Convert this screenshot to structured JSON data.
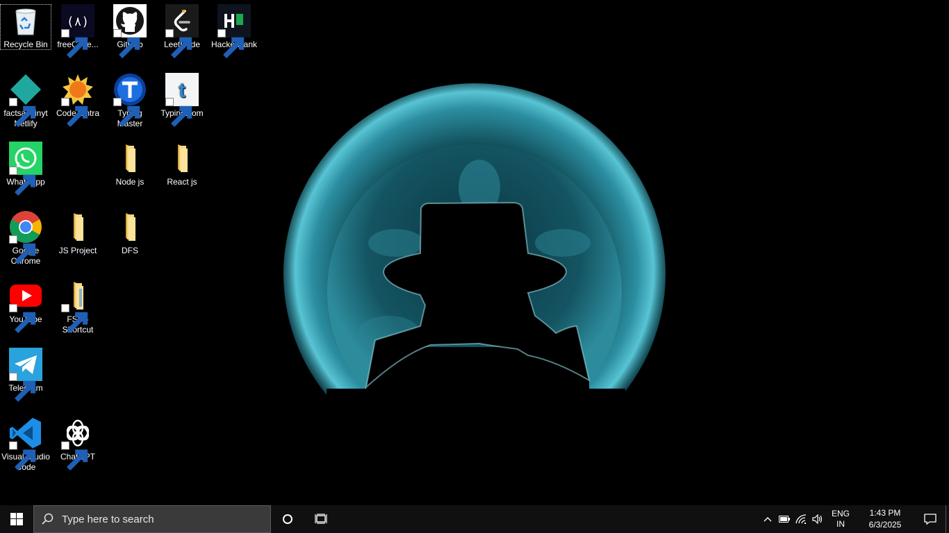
{
  "desktop": {
    "icons": [
      {
        "label": "Recycle Bin",
        "icon": "recycle-bin-icon"
      },
      {
        "label": "freeCode...",
        "icon": "freecodecamp-icon"
      },
      {
        "label": "GitHub",
        "icon": "github-icon"
      },
      {
        "label": "LeetCode",
        "icon": "leetcode-icon"
      },
      {
        "label": "HackerRank",
        "icon": "hackerrank-icon"
      },
      {
        "label": "factsachinyt Netlify",
        "icon": "netlify-icon"
      },
      {
        "label": "CodeTantra",
        "icon": "codetantra-icon"
      },
      {
        "label": "Typing Master",
        "icon": "typing-master-icon"
      },
      {
        "label": "Typing.com",
        "icon": "typing-com-icon"
      },
      {
        "label": "WhatsApp",
        "icon": "whatsapp-icon"
      },
      {
        "label": "Node js",
        "icon": "folder-icon"
      },
      {
        "label": "React js",
        "icon": "folder-icon"
      },
      {
        "label": "Google Chrome",
        "icon": "chrome-icon"
      },
      {
        "label": "JS Project",
        "icon": "folder-icon"
      },
      {
        "label": "DFS",
        "icon": "folder-icon"
      },
      {
        "label": "YouTube",
        "icon": "youtube-icon"
      },
      {
        "label": "FSD - Shortcut",
        "icon": "folder-shortcut-icon"
      },
      {
        "label": "Telegram",
        "icon": "telegram-icon"
      },
      {
        "label": "Visual Studio Code",
        "icon": "vscode-icon"
      },
      {
        "label": "ChatGPT",
        "icon": "chatgpt-icon"
      }
    ]
  },
  "taskbar": {
    "search_placeholder": "Type here to search",
    "start_icon": "windows-logo-icon",
    "cortana_icon": "cortana-circle-icon",
    "task_view_icon": "task-view-icon",
    "language_line1": "ENG",
    "language_line2": "IN",
    "time": "1:43 PM",
    "date": "6/3/2025"
  },
  "colors": {
    "taskbar_bg": "#101010",
    "search_bg": "#3a3a3a",
    "wallpaper_glow": "#2fa6b8"
  }
}
